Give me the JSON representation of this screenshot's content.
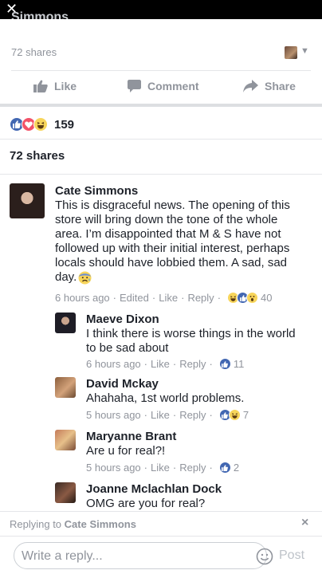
{
  "topbar": {
    "close_glyph": "✕",
    "peek_text": "Simmons"
  },
  "post": {
    "shares_text": "72 shares",
    "actions": {
      "like": "Like",
      "comment": "Comment",
      "share": "Share"
    }
  },
  "reactions": {
    "types": [
      "like",
      "love",
      "haha"
    ],
    "count": "159"
  },
  "shares_header": "72 shares",
  "comments": [
    {
      "name": "Cate Simmons",
      "lines": [
        "This is disgraceful news.  The opening of this",
        "store will bring down the tone of the whole",
        "area.  I’m disappointed that M & S have not",
        "followed up with their initial interest, perhaps",
        "locals should have lobbied them.  A sad, sad",
        "day."
      ],
      "time": "6 hours ago",
      "edited": "Edited",
      "like": "Like",
      "reply": "Reply",
      "reaction_icons": [
        "haha",
        "like",
        "wow"
      ],
      "reaction_count": "40"
    },
    {
      "name": "Maeve Dixon",
      "lines": [
        "I think there is worse things in the world",
        "to be sad about"
      ],
      "time": "6 hours ago",
      "like": "Like",
      "reply": "Reply",
      "reaction_icons": [
        "like"
      ],
      "reaction_count": "11"
    },
    {
      "name": "David Mckay",
      "lines": [
        "Ahahaha, 1st world problems."
      ],
      "time": "5 hours ago",
      "like": "Like",
      "reply": "Reply",
      "reaction_icons": [
        "like",
        "haha"
      ],
      "reaction_count": "7"
    },
    {
      "name": "Maryanne Brant",
      "lines": [
        "Are u for real?!"
      ],
      "time": "5 hours ago",
      "like": "Like",
      "reply": "Reply",
      "reaction_icons": [
        "like"
      ],
      "reaction_count": "2"
    },
    {
      "name": "Joanne Mclachlan Dock",
      "lines": [
        "OMG are you for real?"
      ]
    }
  ],
  "reply_bar": {
    "prefix": "Replying to",
    "target": "Cate Simmons",
    "close": "×"
  },
  "composer": {
    "placeholder": "Write a reply...",
    "post_label": "Post"
  },
  "colors": {
    "fb_blue": "#4267b2",
    "love_red": "#f25268",
    "haha_yellow": "#f7d55b",
    "meta_grey": "#90949c"
  }
}
